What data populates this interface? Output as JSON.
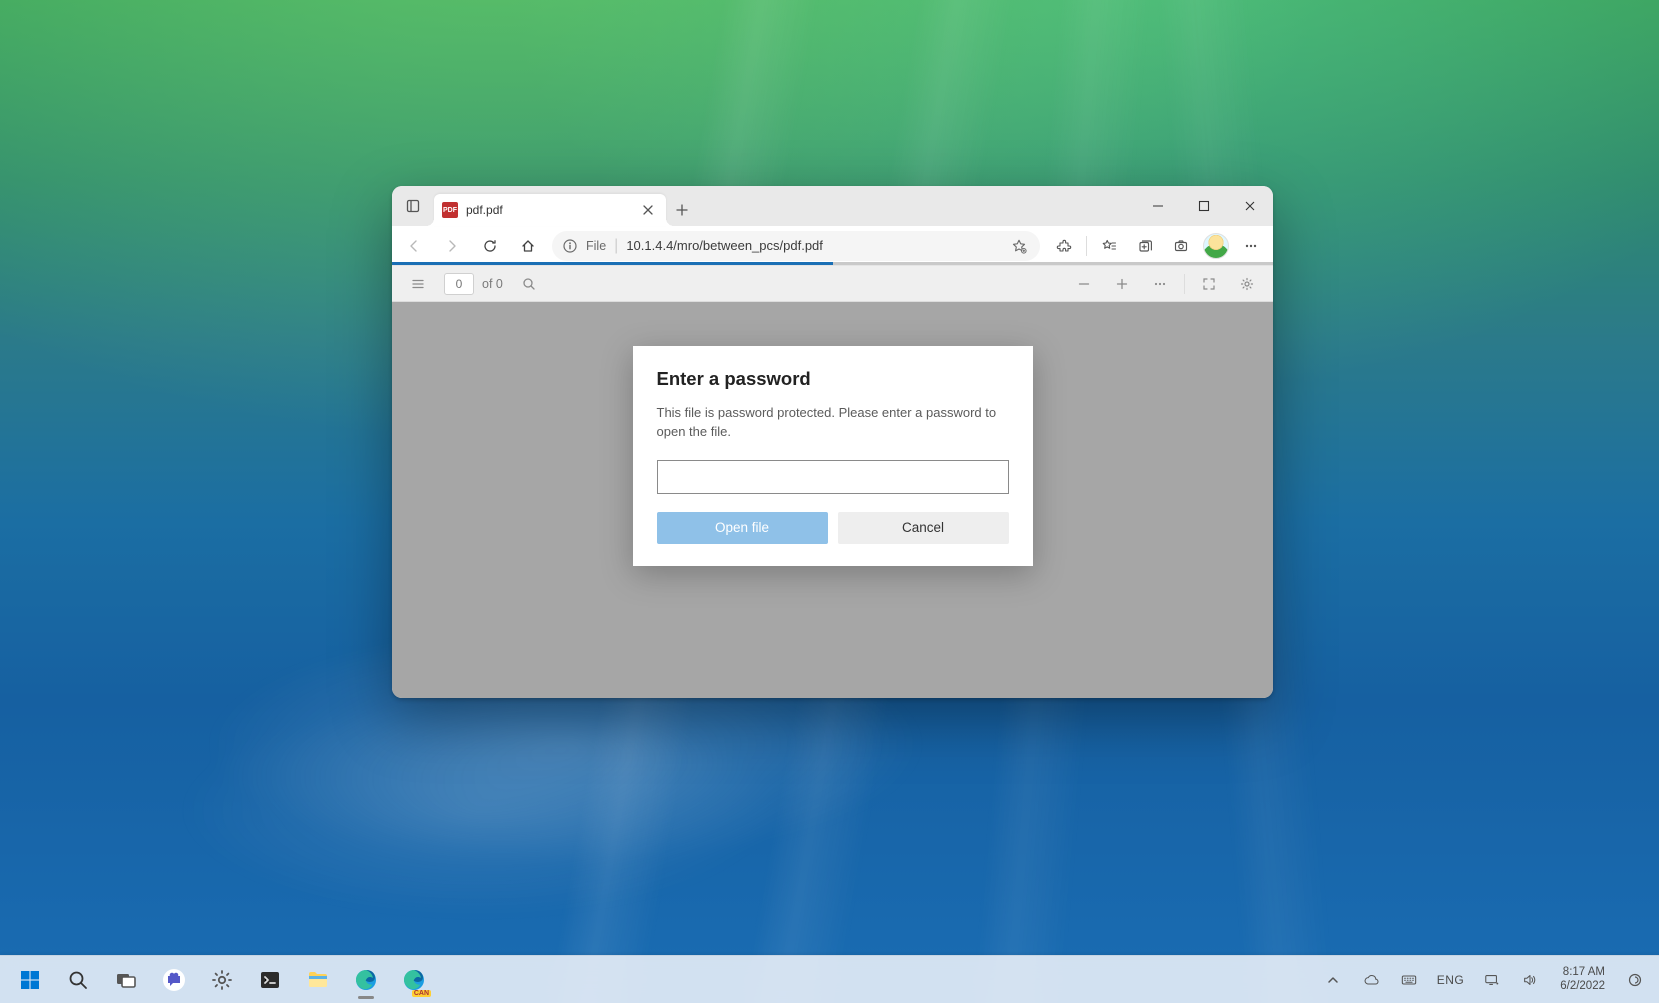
{
  "browser": {
    "tab": {
      "title": "pdf.pdf",
      "badge": "PDF"
    },
    "address": {
      "scheme": "File",
      "url": "10.1.4.4/mro/between_pcs/pdf.pdf"
    },
    "pdf": {
      "page_input": "0",
      "page_total": "of 0",
      "progress_pct": 50
    },
    "dialog": {
      "title": "Enter a password",
      "message": "This file is password protected. Please enter a password to open the file.",
      "open_label": "Open file",
      "cancel_label": "Cancel",
      "password_value": ""
    }
  },
  "taskbar": {
    "apps": [
      {
        "name": "start",
        "label": "Start"
      },
      {
        "name": "search",
        "label": "Search"
      },
      {
        "name": "task-view",
        "label": "Task View"
      },
      {
        "name": "teams-chat",
        "label": "Chat"
      },
      {
        "name": "settings",
        "label": "Settings"
      },
      {
        "name": "terminal",
        "label": "Terminal"
      },
      {
        "name": "file-explorer",
        "label": "File Explorer"
      },
      {
        "name": "edge",
        "label": "Microsoft Edge"
      },
      {
        "name": "edge-canary",
        "label": "Microsoft Edge Canary"
      }
    ],
    "tray": {
      "lang": "ENG",
      "time": "8:17 AM",
      "date": "6/2/2022"
    }
  }
}
